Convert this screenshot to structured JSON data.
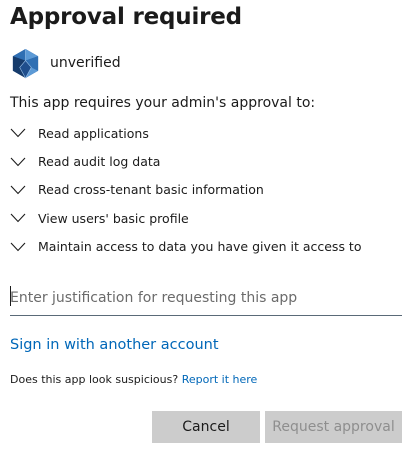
{
  "dialog": {
    "title": "Approval required"
  },
  "app": {
    "name": "unverified",
    "logo_icon": "app-logo-icon",
    "logo_colors": [
      "#1f4e8c",
      "#2f6fb3",
      "#5c9ad6",
      "#163b6b"
    ]
  },
  "permissions": {
    "intro": "This app requires your admin's approval to:",
    "expand_icon": "chevron-down-icon",
    "items": [
      {
        "label": "Read applications"
      },
      {
        "label": "Read audit log data"
      },
      {
        "label": "Read cross-tenant basic information"
      },
      {
        "label": "View users' basic profile"
      },
      {
        "label": "Maintain access to data you have given it access to"
      }
    ]
  },
  "justification": {
    "placeholder": "Enter justification for requesting this app",
    "value": ""
  },
  "links": {
    "sign_in_other": "Sign in with another account",
    "suspicious_prompt": "Does this app look suspicious?",
    "report": "Report it here"
  },
  "buttons": {
    "cancel": "Cancel",
    "request_approval": "Request approval"
  },
  "colors": {
    "accent_link": "#0067b8",
    "button_bg": "#cccccc",
    "disabled_text": "#8e8e8e"
  }
}
